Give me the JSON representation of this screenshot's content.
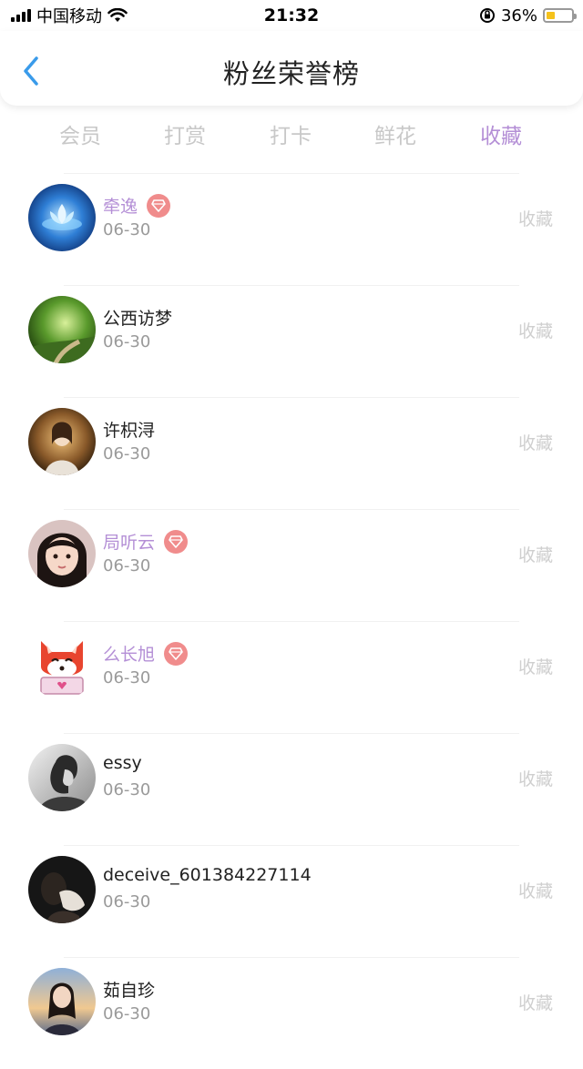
{
  "status_bar": {
    "carrier": "中国移动",
    "time": "21:32",
    "battery_percent": "36%",
    "battery_level": 0.36,
    "icons": [
      "signal-icon",
      "wifi-icon",
      "orientation-lock-icon",
      "battery-icon"
    ]
  },
  "header": {
    "title": "粉丝荣誉榜",
    "back_icon": "chevron-left-icon"
  },
  "tabs": [
    {
      "label": "会员",
      "active": false
    },
    {
      "label": "打赏",
      "active": false
    },
    {
      "label": "打卡",
      "active": false
    },
    {
      "label": "鲜花",
      "active": false
    },
    {
      "label": "收藏",
      "active": true
    }
  ],
  "colors": {
    "accent": "#b48fd6",
    "vip_badge": "#f08c8c",
    "muted_text": "#9a9a9a",
    "back_arrow": "#3a9bea"
  },
  "fans": [
    {
      "name": "牵逸",
      "date": "06-30",
      "action": "收藏",
      "vip": true,
      "avatar": "lotus-avatar"
    },
    {
      "name": "公西访梦",
      "date": "06-30",
      "action": "收藏",
      "vip": false,
      "avatar": "forest-avatar"
    },
    {
      "name": "许枳浔",
      "date": "06-30",
      "action": "收藏",
      "vip": false,
      "avatar": "portrait-avatar"
    },
    {
      "name": "局听云",
      "date": "06-30",
      "action": "收藏",
      "vip": true,
      "avatar": "girl-avatar"
    },
    {
      "name": "么长旭",
      "date": "06-30",
      "action": "收藏",
      "vip": true,
      "avatar": "fox-avatar"
    },
    {
      "name": "essy",
      "date": "06-30",
      "action": "收藏",
      "vip": false,
      "avatar": "bw-portrait-avatar"
    },
    {
      "name": "deceive_601384227114",
      "date": "06-30",
      "action": "收藏",
      "vip": false,
      "avatar": "dark-portrait-avatar"
    },
    {
      "name": "茹自珍",
      "date": "06-30",
      "action": "收藏",
      "vip": false,
      "avatar": "sunset-portrait-avatar"
    }
  ]
}
